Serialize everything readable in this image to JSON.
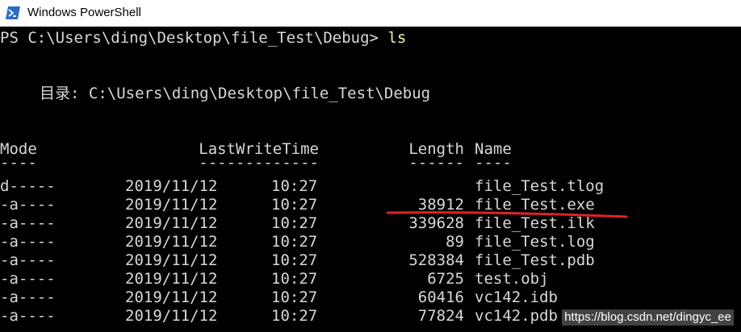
{
  "window": {
    "title": "Windows PowerShell",
    "icon": "powershell-icon"
  },
  "console": {
    "prompt": "PS C:\\Users\\ding\\Desktop\\file_Test\\Debug>",
    "command": "ls",
    "directory_label": "目录: C:\\Users\\ding\\Desktop\\file_Test\\Debug",
    "headers": {
      "mode": "Mode",
      "time": "LastWriteTime",
      "length": "Length",
      "name": "Name"
    },
    "separators": {
      "mode": "----",
      "time": "-------------",
      "length": "------",
      "name": "----"
    },
    "rows": [
      {
        "mode": "d-----",
        "date": "2019/11/12",
        "time": "10:27",
        "length": "",
        "name": "file_Test.tlog"
      },
      {
        "mode": "-a----",
        "date": "2019/11/12",
        "time": "10:27",
        "length": "38912",
        "name": "file_Test.exe"
      },
      {
        "mode": "-a----",
        "date": "2019/11/12",
        "time": "10:27",
        "length": "339628",
        "name": "file_Test.ilk"
      },
      {
        "mode": "-a----",
        "date": "2019/11/12",
        "time": "10:27",
        "length": "89",
        "name": "file_Test.log"
      },
      {
        "mode": "-a----",
        "date": "2019/11/12",
        "time": "10:27",
        "length": "528384",
        "name": "file_Test.pdb"
      },
      {
        "mode": "-a----",
        "date": "2019/11/12",
        "time": "10:27",
        "length": "6725",
        "name": "test.obj"
      },
      {
        "mode": "-a----",
        "date": "2019/11/12",
        "time": "10:27",
        "length": "60416",
        "name": "vc142.idb"
      },
      {
        "mode": "-a----",
        "date": "2019/11/12",
        "time": "10:27",
        "length": "77824",
        "name": "vc142.pdb"
      }
    ]
  },
  "watermark": "https://blog.csdn.net/dingyc_ee",
  "colors": {
    "background": "#000000",
    "text": "#d8d8d8",
    "command": "#f2f2a0",
    "annotation": "#e0202a"
  }
}
